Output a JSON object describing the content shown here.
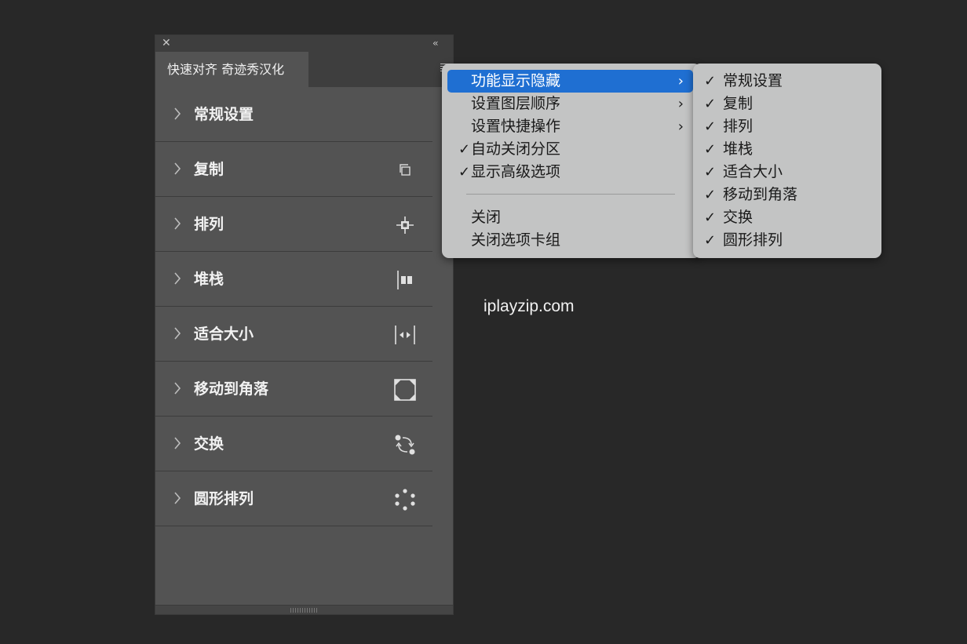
{
  "panel": {
    "tab_title": "快速对齐 奇迹秀汉化",
    "close_glyph": "✕",
    "collapse_glyph": "‹‹",
    "items": [
      {
        "label": "常规设置",
        "icon": "none"
      },
      {
        "label": "复制",
        "icon": "copy-icon"
      },
      {
        "label": "排列",
        "icon": "align-center-icon"
      },
      {
        "label": "堆栈",
        "icon": "stack-icon"
      },
      {
        "label": "适合大小",
        "icon": "fit-size-icon"
      },
      {
        "label": "移动到角落",
        "icon": "move-corner-icon"
      },
      {
        "label": "交换",
        "icon": "swap-icon"
      },
      {
        "label": "圆形排列",
        "icon": "circle-arrange-icon"
      }
    ]
  },
  "menu": {
    "items": [
      {
        "label": "功能显示隐藏",
        "submenu": true,
        "highlighted": true,
        "checked": false
      },
      {
        "label": "设置图层顺序",
        "submenu": true,
        "highlighted": false,
        "checked": false
      },
      {
        "label": "设置快捷操作",
        "submenu": true,
        "highlighted": false,
        "checked": false
      },
      {
        "label": "自动关闭分区",
        "submenu": false,
        "highlighted": false,
        "checked": true
      },
      {
        "label": "显示高级选项",
        "submenu": false,
        "highlighted": false,
        "checked": true
      },
      {
        "label": "关闭",
        "submenu": false,
        "highlighted": false,
        "checked": false
      },
      {
        "label": "关闭选项卡组",
        "submenu": false,
        "highlighted": false,
        "checked": false
      }
    ],
    "submenu_arrow": "›",
    "check_glyph": "✓"
  },
  "submenu": {
    "items": [
      {
        "label": "常规设置",
        "checked": true
      },
      {
        "label": "复制",
        "checked": true
      },
      {
        "label": "排列",
        "checked": true
      },
      {
        "label": "堆栈",
        "checked": true
      },
      {
        "label": "适合大小",
        "checked": true
      },
      {
        "label": "移动到角落",
        "checked": true
      },
      {
        "label": "交换",
        "checked": true
      },
      {
        "label": "圆形排列",
        "checked": true
      }
    ]
  },
  "watermark": "iplayzip.com",
  "colors": {
    "background": "#282828",
    "panel": "#535353",
    "menu": "#c3c4c4",
    "highlight": "#1f6fd2"
  }
}
